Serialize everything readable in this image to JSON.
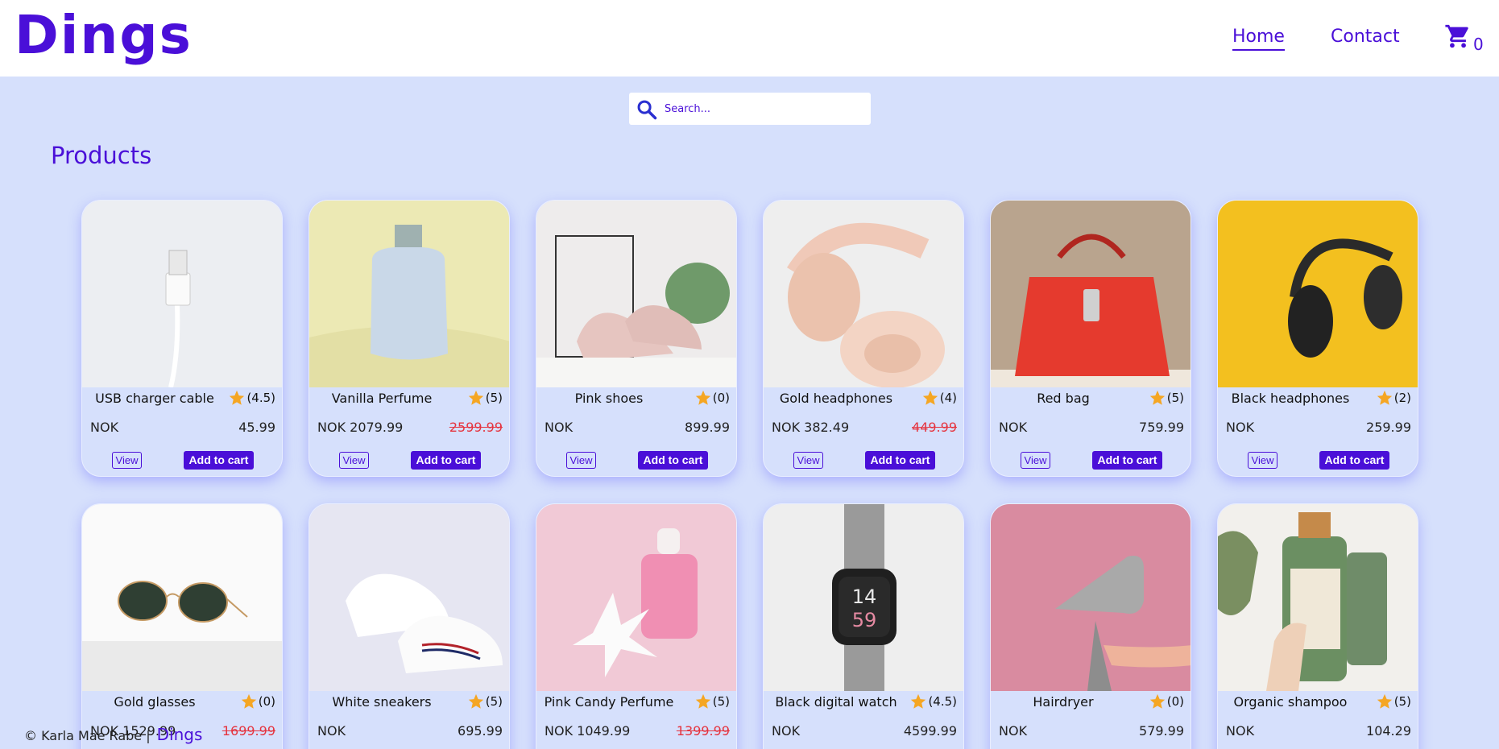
{
  "header": {
    "logo": "Dings",
    "nav": [
      {
        "label": "Home",
        "active": true
      },
      {
        "label": "Contact",
        "active": false
      }
    ],
    "cart_count": "0",
    "cart_icon": "shopping-cart-icon"
  },
  "search": {
    "placeholder": "Search...",
    "value": "",
    "icon": "search-icon"
  },
  "products_title": "Products",
  "colors": {
    "brand": "#4a0fd8",
    "background": "#d6e0fc",
    "star": "#f5a623",
    "old_price": "#e5343f"
  },
  "buttons": {
    "view": "View",
    "add_to_cart": "Add to cart"
  },
  "products": [
    {
      "name": "USB charger cable",
      "rating": "(4.5)",
      "currency": "NOK",
      "price": "45.99",
      "old_price": "",
      "image": "usb-cable"
    },
    {
      "name": "Vanilla Perfume",
      "rating": "(5)",
      "currency": "NOK 2079.99",
      "price": "",
      "old_price": "2599.99",
      "image": "perfume-bottle"
    },
    {
      "name": "Pink shoes",
      "rating": "(0)",
      "currency": "NOK",
      "price": "899.99",
      "old_price": "",
      "image": "pink-shoes"
    },
    {
      "name": "Gold headphones",
      "rating": "(4)",
      "currency": "NOK 382.49",
      "price": "",
      "old_price": "449.99",
      "image": "gold-headphones"
    },
    {
      "name": "Red bag",
      "rating": "(5)",
      "currency": "NOK",
      "price": "759.99",
      "old_price": "",
      "image": "red-bag"
    },
    {
      "name": "Black headphones",
      "rating": "(2)",
      "currency": "NOK",
      "price": "259.99",
      "old_price": "",
      "image": "black-headphones"
    },
    {
      "name": "Gold glasses",
      "rating": "(0)",
      "currency": "NOK 1529.99",
      "price": "",
      "old_price": "1699.99",
      "image": "sunglasses"
    },
    {
      "name": "White sneakers",
      "rating": "(5)",
      "currency": "NOK",
      "price": "695.99",
      "old_price": "",
      "image": "white-sneakers"
    },
    {
      "name": "Pink Candy Perfume",
      "rating": "(5)",
      "currency": "NOK 1049.99",
      "price": "",
      "old_price": "1399.99",
      "image": "pink-perfume"
    },
    {
      "name": "Black digital watch",
      "rating": "(4.5)",
      "currency": "NOK",
      "price": "4599.99",
      "old_price": "",
      "image": "smart-watch"
    },
    {
      "name": "Hairdryer",
      "rating": "(0)",
      "currency": "NOK",
      "price": "579.99",
      "old_price": "",
      "image": "hairdryer"
    },
    {
      "name": "Organic shampoo",
      "rating": "(5)",
      "currency": "NOK",
      "price": "104.29",
      "old_price": "",
      "image": "shampoo-bottles"
    }
  ],
  "footer": {
    "copyright": "© Karla Mae Rabe |",
    "brand": "Dings"
  }
}
